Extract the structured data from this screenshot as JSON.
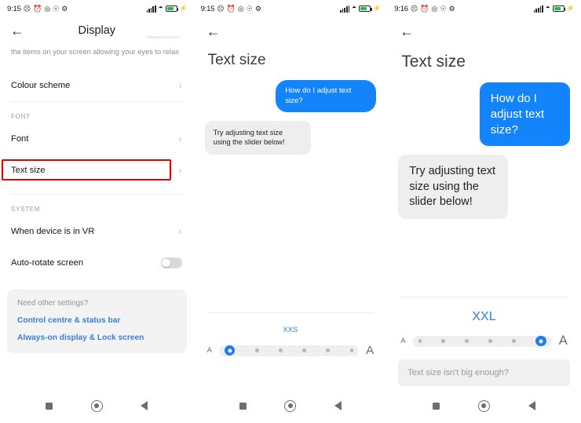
{
  "panels": [
    {
      "id": "display-settings",
      "status": {
        "time": "9:15",
        "icons": [
          "do-not-disturb-icon",
          "alarm-icon",
          "headset-icon",
          "shield-icon",
          "gear-icon"
        ],
        "signal": "signal-icon",
        "wifi": "wifi-icon",
        "battery": "battery-charging-icon",
        "battery_level": 72
      },
      "title": "Display",
      "back": "back-arrow-icon",
      "description": "the items on your screen allowing your eyes to relax",
      "rows": [
        {
          "label": "Colour scheme",
          "accessory": "chevron"
        }
      ],
      "sections": [
        {
          "header": "FONT",
          "rows": [
            {
              "label": "Font",
              "accessory": "chevron"
            },
            {
              "label": "Text size",
              "accessory": "chevron",
              "highlighted": true
            }
          ]
        },
        {
          "header": "SYSTEM",
          "rows": [
            {
              "label": "When device is in VR",
              "accessory": "chevron"
            },
            {
              "label": "Auto-rotate screen",
              "accessory": "toggle",
              "toggle_on": false
            }
          ]
        }
      ],
      "card": {
        "question": "Need other settings?",
        "links": [
          "Control centre & status bar",
          "Always-on display & Lock screen"
        ]
      },
      "highlight_color": "#e60000"
    },
    {
      "id": "text-size-xxs",
      "status": {
        "time": "9:15",
        "battery_level": 72
      },
      "title": "Text size",
      "back": "back-arrow-icon",
      "messages": [
        {
          "side": "sent",
          "text": "How do I adjust text size?"
        },
        {
          "side": "received",
          "text": "Try adjusting text size using the slider below!"
        }
      ],
      "slider": {
        "label": "XXS",
        "label_color": "#2f7fe0",
        "steps": 6,
        "selected_index": 0,
        "left_icon": "A",
        "right_icon": "A",
        "accent": "#1e7ef0"
      }
    },
    {
      "id": "text-size-xxl",
      "status": {
        "time": "9:16",
        "battery_level": 72
      },
      "title": "Text size",
      "back": "back-arrow-icon",
      "messages": [
        {
          "side": "sent",
          "text": "How do I adjust text size?"
        },
        {
          "side": "received",
          "text": "Try adjusting text size using the slider below!"
        }
      ],
      "slider": {
        "label": "XXL",
        "label_color": "#2f80e8",
        "steps": 6,
        "selected_index": 5,
        "left_icon": "A",
        "right_icon": "A",
        "accent": "#1e7ef0"
      },
      "input": {
        "placeholder": "Text size isn't big enough?",
        "value": "Text size isn't big enough?"
      }
    }
  ],
  "navbar": {
    "recents": "recents-square-icon",
    "home": "home-circle-icon",
    "back": "back-triangle-icon"
  }
}
